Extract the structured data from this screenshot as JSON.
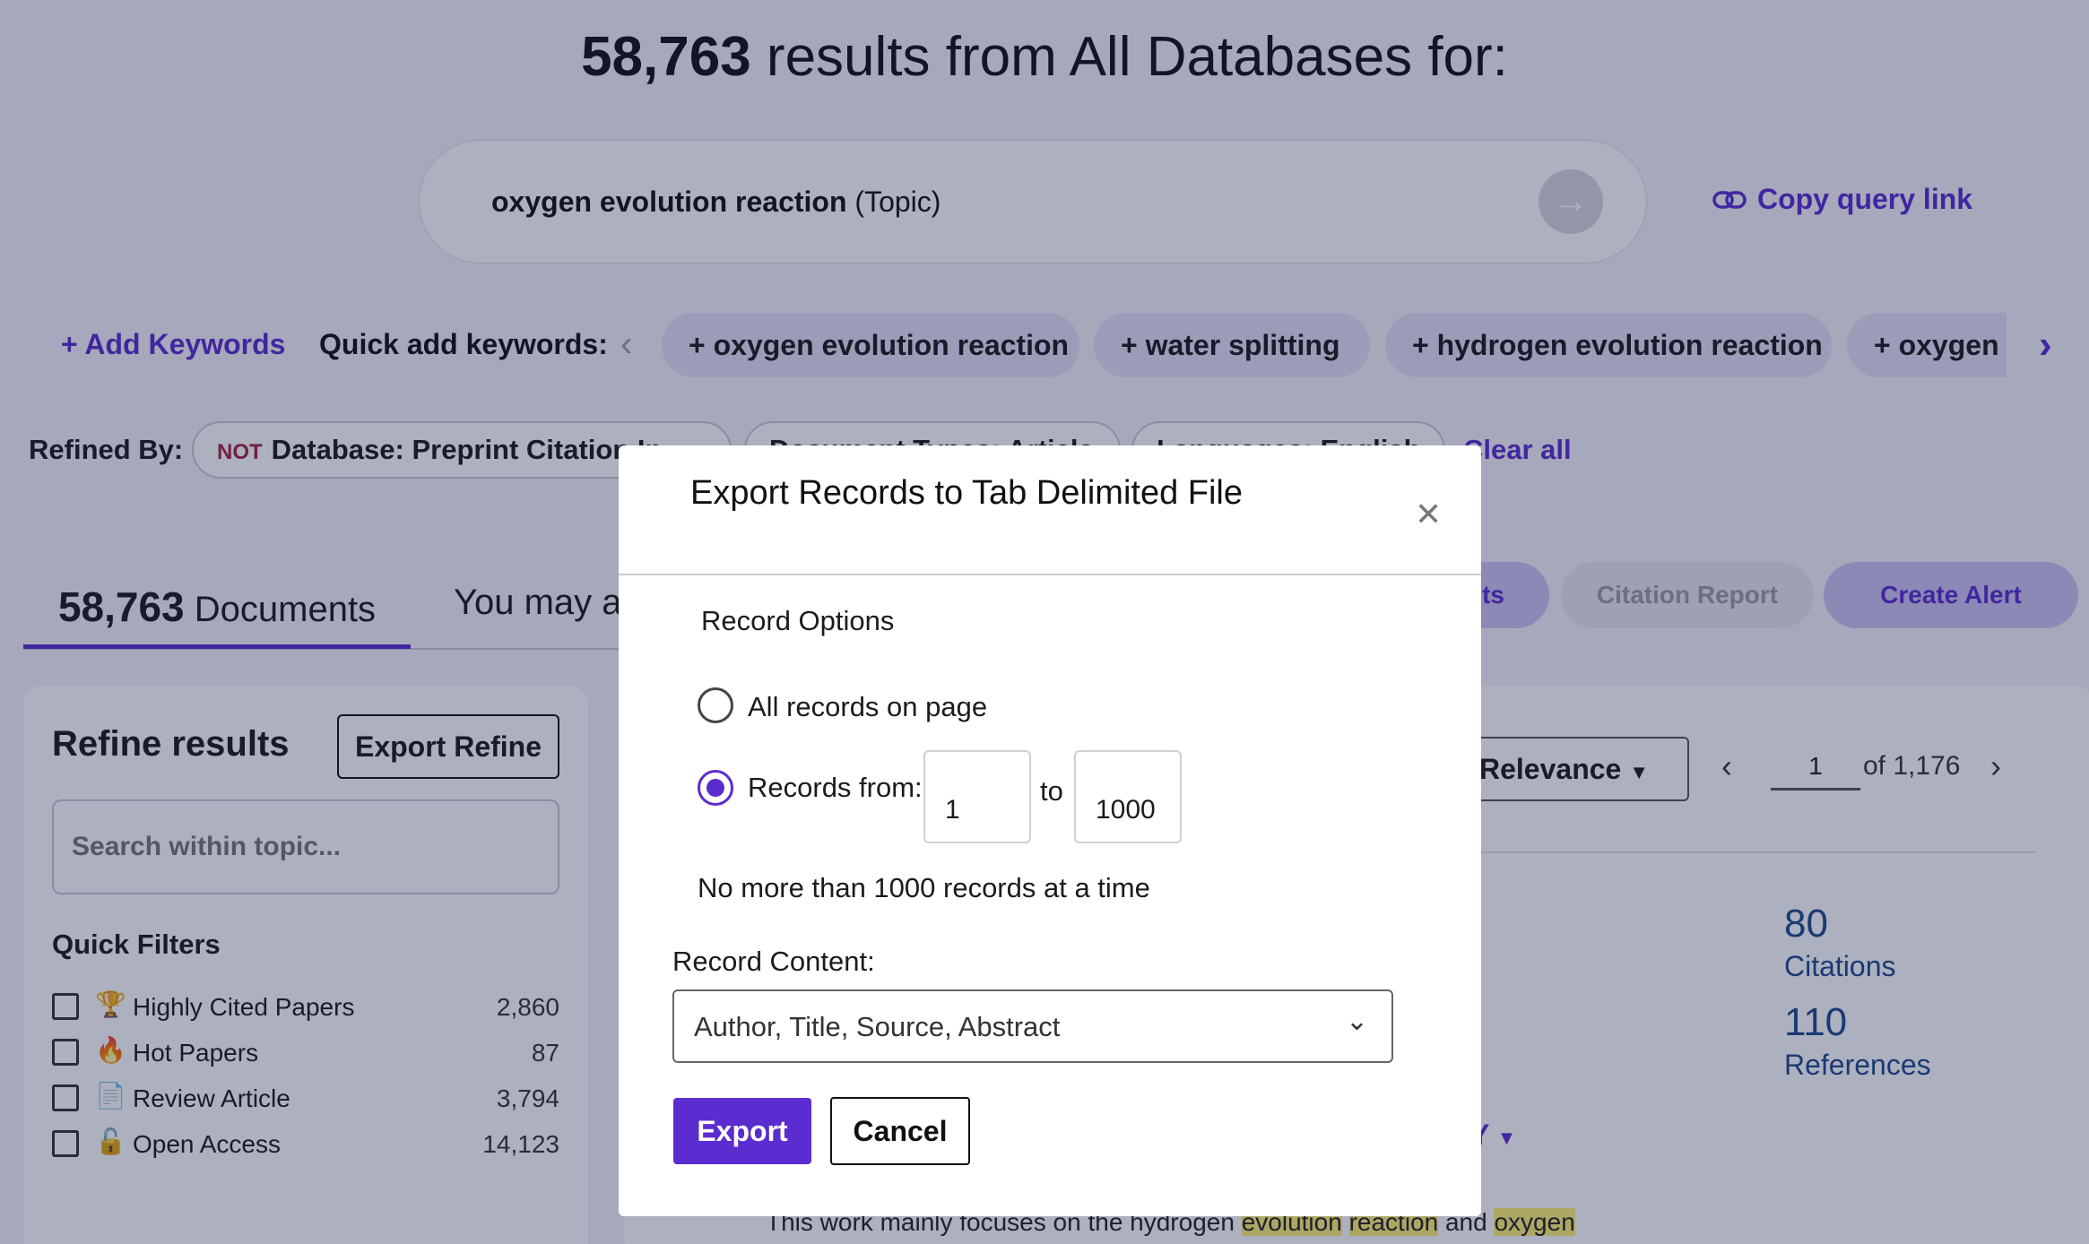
{
  "header": {
    "count": "58,763",
    "title_rest": " results from All Databases for:"
  },
  "search": {
    "query": "oxygen evolution reaction",
    "field": " (Topic)",
    "go_icon": "arrow-right-icon"
  },
  "copy_link": {
    "label": "Copy query link",
    "icon": "link-icon"
  },
  "keywords": {
    "add_label": "Add Keywords",
    "quick_label": "Quick add keywords:",
    "chips": [
      "oxygen evolution reaction",
      "water splitting",
      "hydrogen evolution reaction",
      "oxygen"
    ]
  },
  "refined": {
    "label": "Refined By:",
    "chips": [
      {
        "not": "NOT",
        "text": "Database: Preprint Citation In"
      },
      {
        "not": "",
        "text": "Document Types: Article"
      },
      {
        "not": "",
        "text": "Languages: English"
      }
    ],
    "clear_all": "Clear all"
  },
  "tabs": {
    "docs_count": "58,763",
    "docs_label": " Documents",
    "maybe_label": "You may als"
  },
  "actions": {
    "analyze": "lts",
    "citation_report": "Citation Report",
    "create_alert": "Create Alert"
  },
  "refine": {
    "title": "Refine results",
    "export_label": "Export Refine",
    "search_placeholder": "Search within topic...",
    "quick_filters_title": "Quick Filters",
    "filters": [
      {
        "label": "Highly Cited Papers",
        "count": "2,860",
        "icon": "trophy-icon"
      },
      {
        "label": "Hot Papers",
        "count": "87",
        "icon": "flame-icon"
      },
      {
        "label": "Review Article",
        "count": "3,794",
        "icon": "document-icon"
      },
      {
        "label": "Open Access",
        "count": "14,123",
        "icon": "lock-open-icon"
      }
    ]
  },
  "results": {
    "sort_label": "Relevance",
    "page_current": "1",
    "page_of": "of 1,176",
    "citations_num": "80",
    "citations_label": "Citations",
    "references_num": "110",
    "references_label": "References",
    "cy_label": "Y",
    "snippet_pre": "This work mainly focuses on the hydrogen ",
    "snippet_hl1": "evolution",
    "snippet_hl2": "reaction",
    "snippet_mid": " and ",
    "snippet_hl3": "oxygen"
  },
  "modal": {
    "title": "Export Records to Tab Delimited File",
    "record_options": "Record Options",
    "all_records": "All records on page",
    "records_from": "Records from:",
    "from_value": "1",
    "to_label": "to",
    "to_value": "1000",
    "limit_note": "No more than 1000 records at a time",
    "content_label": "Record Content:",
    "content_value": "Author, Title, Source, Abstract",
    "export_btn": "Export",
    "cancel_btn": "Cancel"
  },
  "colors": {
    "accent": "#5b2ccf",
    "overlay": "#141c46",
    "metric": "#1e4a8a",
    "not_tag": "#a1243d"
  }
}
